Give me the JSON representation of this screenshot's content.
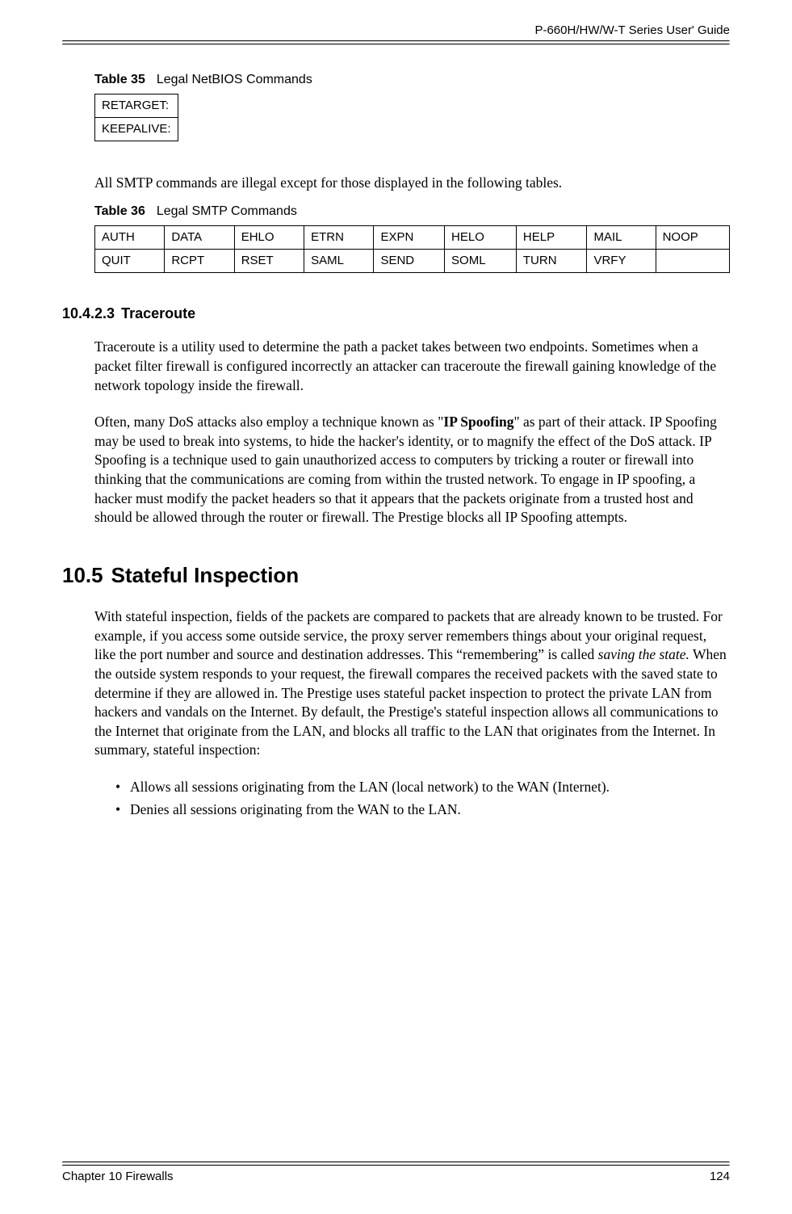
{
  "header": {
    "guide_title": "P-660H/HW/W-T Series User' Guide"
  },
  "table35": {
    "caption_num": "Table 35",
    "caption_text": "Legal NetBIOS Commands",
    "rows": [
      "RETARGET:",
      "KEEPALIVE:"
    ]
  },
  "para_smtp_intro": "All SMTP commands are illegal except for those displayed in the following tables.",
  "table36": {
    "caption_num": "Table 36",
    "caption_text": "Legal SMTP Commands",
    "rows": [
      [
        "AUTH",
        "DATA",
        "EHLO",
        "ETRN",
        "EXPN",
        "HELO",
        "HELP",
        "MAIL",
        "NOOP"
      ],
      [
        "QUIT",
        "RCPT",
        "RSET",
        "SAML",
        "SEND",
        "SOML",
        "TURN",
        "VRFY",
        ""
      ]
    ]
  },
  "sec_10_4_2_3": {
    "num": "10.4.2.3",
    "title": "Traceroute",
    "para1": "Traceroute is a utility used to determine the path a packet takes between two endpoints. Sometimes when a packet filter firewall is configured incorrectly an attacker can traceroute the firewall gaining knowledge of the network topology inside the firewall.",
    "para2_pre": "Often, many DoS attacks also employ a technique known as \"",
    "para2_bold": "IP Spoofing",
    "para2_post": "\" as part of their attack. IP Spoofing may be used to break into systems, to hide the hacker's identity, or to magnify the effect of the DoS attack. IP Spoofing is a technique used to gain unauthorized access to computers by tricking a router or firewall into thinking that the communications are coming from within the trusted network. To engage in IP spoofing, a hacker must modify the packet headers so that it appears that the packets originate from a trusted host and should be allowed through the router or firewall. The Prestige blocks all IP Spoofing attempts."
  },
  "sec_10_5": {
    "num": "10.5",
    "title": "Stateful Inspection",
    "para_pre": "With stateful inspection, fields of the packets are compared to packets that are already known to be trusted. For example, if you access some outside service, the proxy server remembers things about your original request, like the port number and source and destination addresses. This “remembering” is called ",
    "para_italic": "saving the state.",
    "para_post": " When the outside system responds to your request, the firewall compares the received packets with the saved state to determine if they are allowed in. The Prestige uses stateful packet inspection to protect the private LAN from hackers and vandals on the Internet. By default, the Prestige's stateful inspection allows all communications to the Internet that originate from the LAN, and blocks all traffic to the LAN that originates from the Internet. In summary, stateful inspection:",
    "bullets": [
      "Allows all sessions originating from the LAN (local network) to the WAN (Internet).",
      "Denies all sessions originating from the WAN to the LAN."
    ]
  },
  "footer": {
    "chapter": "Chapter 10 Firewalls",
    "page": "124"
  }
}
